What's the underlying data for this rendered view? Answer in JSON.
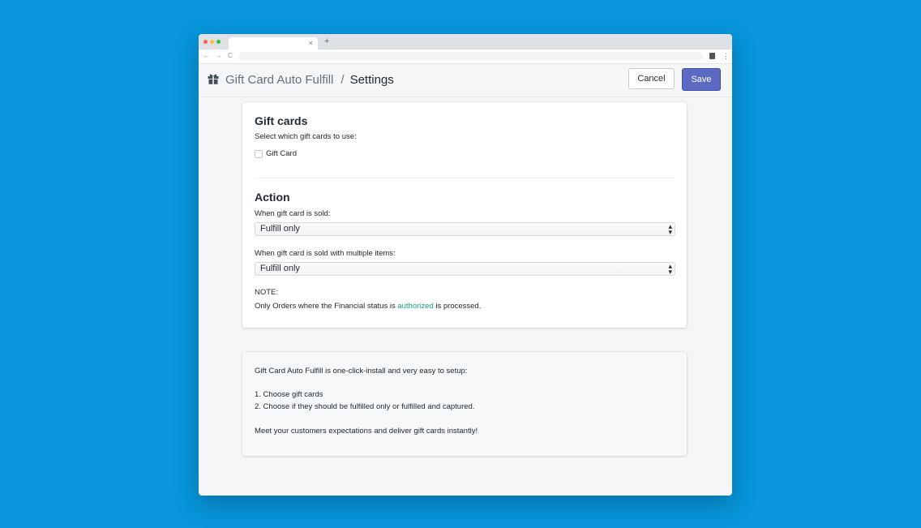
{
  "browser": {
    "tab_close": "×",
    "new_tab": "+",
    "back": "←",
    "forward": "→",
    "reload": "C",
    "menu": "⋮"
  },
  "header": {
    "app_name": "Gift Card Auto Fulfill",
    "separator": "/",
    "page": "Settings",
    "cancel_label": "Cancel",
    "save_label": "Save",
    "save_color": "#5c6ac4"
  },
  "gift_cards": {
    "title": "Gift cards",
    "instruction": "Select which gift cards to use:",
    "options": [
      {
        "label": "Gift Card",
        "checked": false
      }
    ]
  },
  "action": {
    "title": "Action",
    "sold_label": "When gift card is sold:",
    "sold_value": "Fulfill only",
    "multi_label": "When gift card is sold with multiple items:",
    "multi_value": "Fulfill only"
  },
  "note": {
    "heading": "NOTE:",
    "prefix": "Only Orders where the Financial status is ",
    "link": "authorized",
    "suffix": " is processed.",
    "link_color": "#16a085"
  },
  "info": {
    "intro": "Gift Card Auto Fulfill is one-click-install and very easy to setup:",
    "steps": [
      "1. Choose gift cards",
      "2. Choose if they should be fulfilled only or fulfilled and captured."
    ],
    "outro": "Meet your customers expectations and deliver gift cards instantly!"
  }
}
